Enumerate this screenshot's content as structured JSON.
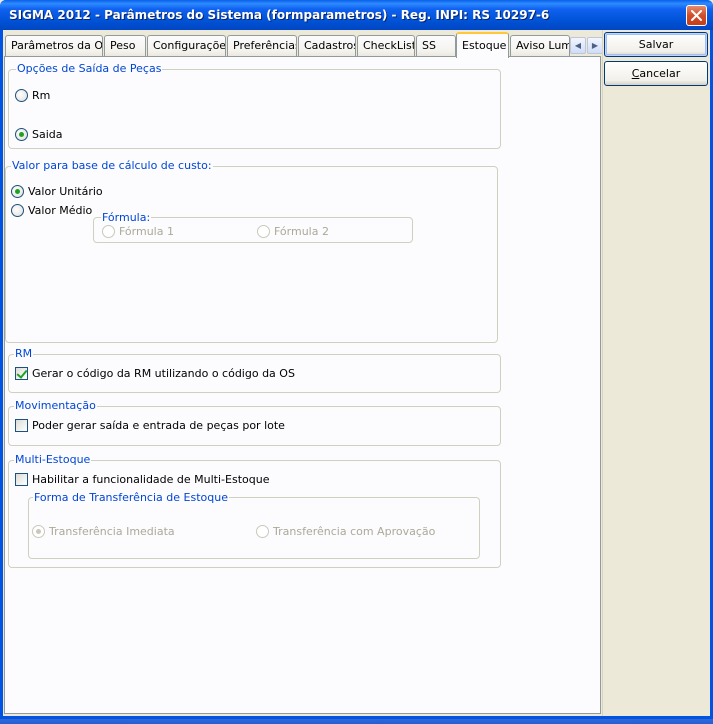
{
  "window": {
    "title": "SIGMA 2012 - Parâmetros do Sistema  (formparametros)  - Reg. INPI: RS 10297-6"
  },
  "tabs": [
    {
      "label": "Parâmetros da OS",
      "active": false
    },
    {
      "label": "Peso",
      "active": false
    },
    {
      "label": "Configurações",
      "active": false
    },
    {
      "label": "Preferências",
      "active": false
    },
    {
      "label": "Cadastros",
      "active": false
    },
    {
      "label": "CheckList",
      "active": false
    },
    {
      "label": "SS",
      "active": false
    },
    {
      "label": "Estoque",
      "active": true
    },
    {
      "label": "Aviso Lumir",
      "active": false
    }
  ],
  "buttons": {
    "save": "Salvar",
    "cancel_first": "C",
    "cancel_rest": "ancelar"
  },
  "saida_pecas": {
    "title": "Opções de Saída de Peças",
    "options": [
      {
        "label": "Rm",
        "checked": false
      },
      {
        "label": "Saida",
        "checked": true
      }
    ]
  },
  "custo": {
    "title": "Valor para base de cálculo de custo:",
    "options": [
      {
        "label": "Valor Unitário",
        "checked": true
      },
      {
        "label": "Valor Médio",
        "checked": false
      }
    ],
    "formula": {
      "title": "Fórmula:",
      "options": [
        {
          "label": "Fórmula 1",
          "checked": false
        },
        {
          "label": "Fórmula 2",
          "checked": false
        }
      ]
    }
  },
  "rm": {
    "title": "RM",
    "checkbox_label": "Gerar o código da RM utilizando o código da OS",
    "checked": true
  },
  "movimentacao": {
    "title": "Movimentação",
    "checkbox_label": "Poder gerar saída e entrada de peças por lote",
    "checked": false
  },
  "multi_estoque": {
    "title": "Multi-Estoque",
    "checkbox_label": "Habilitar a funcionalidade de Multi-Estoque",
    "checked": false,
    "transfer": {
      "title": "Forma de Transferência de Estoque",
      "options": [
        {
          "label": "Transferência Imediata",
          "checked": true
        },
        {
          "label": "Transferência com Aprovação",
          "checked": false
        }
      ]
    }
  }
}
